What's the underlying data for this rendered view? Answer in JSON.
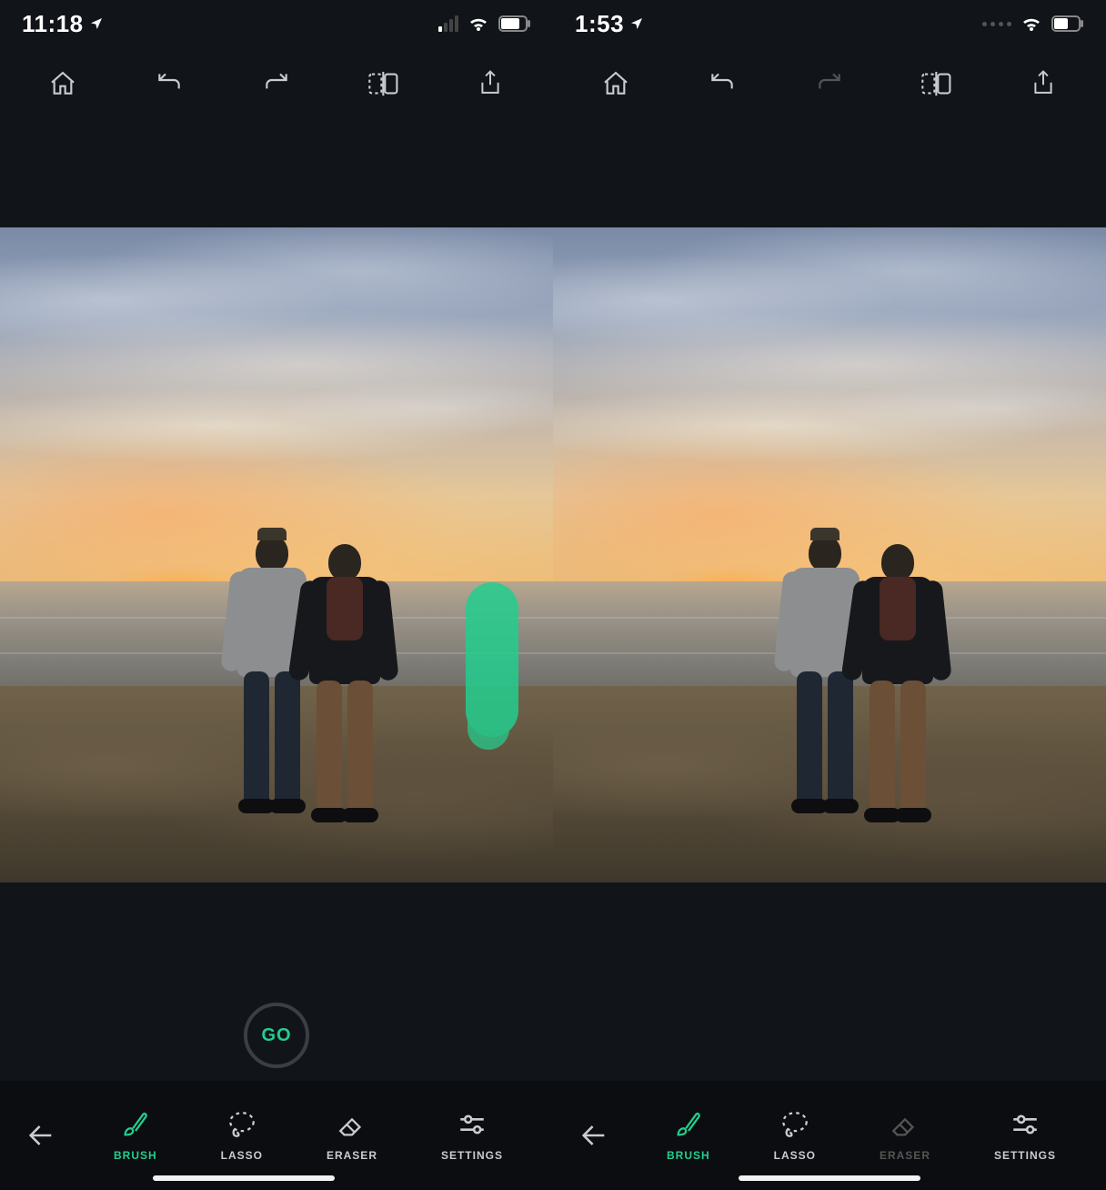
{
  "left": {
    "status": {
      "time": "11:18",
      "signal_bars_active": 1,
      "signal_bars_style": "bars"
    },
    "toolbar": {
      "redo_enabled": true
    },
    "go_label": "GO",
    "show_go": true,
    "show_brush_mark": true,
    "tools": {
      "back": "back",
      "items": [
        {
          "id": "brush",
          "label": "BRUSH",
          "active": true,
          "dim": false
        },
        {
          "id": "lasso",
          "label": "LASSO",
          "active": false,
          "dim": false
        },
        {
          "id": "eraser",
          "label": "ERASER",
          "active": false,
          "dim": false
        },
        {
          "id": "settings",
          "label": "SETTINGS",
          "active": false,
          "dim": false
        }
      ]
    }
  },
  "right": {
    "status": {
      "time": "1:53",
      "signal_bars_style": "dots"
    },
    "toolbar": {
      "redo_enabled": false
    },
    "show_go": false,
    "show_brush_mark": false,
    "tools": {
      "back": "back",
      "items": [
        {
          "id": "brush",
          "label": "BRUSH",
          "active": true,
          "dim": false
        },
        {
          "id": "lasso",
          "label": "LASSO",
          "active": false,
          "dim": false
        },
        {
          "id": "eraser",
          "label": "ERASER",
          "active": false,
          "dim": true
        },
        {
          "id": "settings",
          "label": "SETTINGS",
          "active": false,
          "dim": false
        }
      ]
    }
  },
  "colors": {
    "accent": "#23ce8e"
  }
}
